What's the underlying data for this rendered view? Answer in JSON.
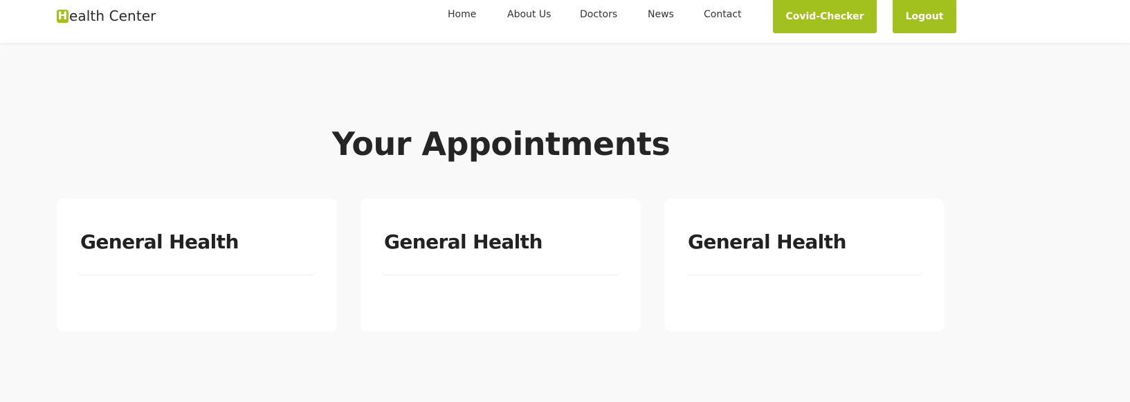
{
  "brand": {
    "initial": "H",
    "rest": "ealth Center",
    "accent_color": "#a2c11e"
  },
  "nav": {
    "links": [
      {
        "label": "Home"
      },
      {
        "label": "About Us"
      },
      {
        "label": "Doctors"
      },
      {
        "label": "News"
      },
      {
        "label": "Contact"
      }
    ],
    "buttons": [
      {
        "label": "Covid-Checker"
      },
      {
        "label": "Logout"
      }
    ]
  },
  "main": {
    "title": "Your Appointments",
    "cards": [
      {
        "title": "General Health"
      },
      {
        "title": "General Health"
      },
      {
        "title": "General Health"
      }
    ]
  }
}
